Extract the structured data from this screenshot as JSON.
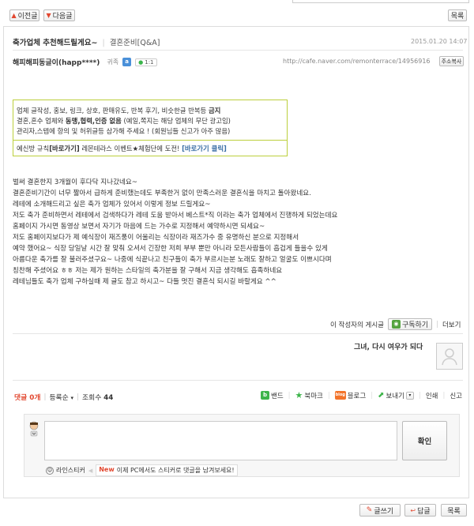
{
  "top_nav": {
    "prev_label": "이전글",
    "next_label": "다음글",
    "list_label": "목록"
  },
  "post": {
    "title": "축가업체 추천해드릴게요~",
    "category": "결혼준비[Q&A]",
    "date": "2015.01.20 14:07",
    "author": "해피해피동글이(happ****)",
    "author_grade": "귀족",
    "comment_badge": "1:1",
    "url": "http://cafe.naver.com/remonterrace/14956916",
    "copy_url_label": "주소복사"
  },
  "notice": {
    "lines": [
      [
        "업체 글작성, 홍보, 링크, 상호, 판매유도, 반복 후기, 비슷한글 반복등 ",
        "금지"
      ],
      [
        "결혼,혼수 업체와 ",
        "동맹,협력,인증 없음",
        " (예일,쪽지는 해당 업체의 무단 광고임)"
      ],
      [
        "관리자,스텝에 항의 및 허위글등 삼가해 주세요 ! (회원님들 신고가 아주 많음)"
      ]
    ],
    "footer_prefix": "예신방 규칙",
    "footer_link1": "[바로가기]",
    "footer_mid": " 레몬테라스 이벤트★체험단에 도전! ",
    "footer_link2": "[바로가기 클릭]"
  },
  "body_lines": [
    "벌써 결혼한지 3개월이 후다닥 지나갔네요~",
    "결혼준비기간이 너무 짧아서 급하게 준비했는데도 부족한거 없이 만족스러운 결혼식을 마치고 돌아왔네요.",
    "레테에 소개해드리고 싶은 축가 업체가 있어서 이렇게 정보 드릴게요~",
    "저도 축가 준비하면서 레테에서 검색하다가 레테 도움 받아서 베스트*직 이라는 축가 업체에서 진행하게 되었는데요",
    "홈페이지 가시면 동영상 보면서 자기가 마음에 드는 가수로 지정해서 예약하시면 되세요~",
    "저도 홈페이지보다가 제 예식장이 재즈풍이 어울리는 식장이라 재즈가수 중 유명하신 분으로 지정해서",
    "예약 했어요~ 식장 당일날 시간 잘 맞춰 오셔서 긴장한 저희 부부 뿐만 아니라 모든사람들이 흡겁게 들을수 있게",
    "아름다운 축가를 잘 불러주셨구요~ 나중에 식끝나고 친구들이 축가 부르시는분 노래도 잘하고 얼굴도 이쁘시다며",
    "칭찬해 주셨어요 ㅎㅎ 저는 제가 원하는 스타일의 축가분을 잘 구해서 지금 생각해도 흡족하네요",
    "레테님들도 축가 업체 구하실때 제 글도 참고 하시고~ 다들 멋진 결혼식 되시길 바랄게요 ^^"
  ],
  "author_bar": {
    "posts_label": "이 작성자의 게시글",
    "subscribe_label": "구독하기",
    "more_label": "더보기"
  },
  "signature": {
    "text": "그녀, 다시 여우가 되다"
  },
  "stats": {
    "comments_label": "댓글",
    "comments_count": "0개",
    "order_label": "등록순",
    "views_label": "조회수",
    "views_count": "44"
  },
  "share": {
    "band": "밴드",
    "bookmark": "북마크",
    "blog": "블로그",
    "send": "보내기",
    "print": "인쇄",
    "report": "신고"
  },
  "comment_form": {
    "submit_label": "확인",
    "sticker_label": "라인스티커",
    "new_badge": "New",
    "sticker_tip": "이제 PC에서도 스티커로 댓글을 남겨보세요!"
  },
  "bottom_bar": {
    "write_label": "글쓰기",
    "reply_label": "답글",
    "list_label": "목록"
  },
  "colors": {
    "accent_red": "#e2472f",
    "notice_border": "#bccf3c",
    "link_blue": "#3a6ea5",
    "rss_green": "#54a33f"
  }
}
